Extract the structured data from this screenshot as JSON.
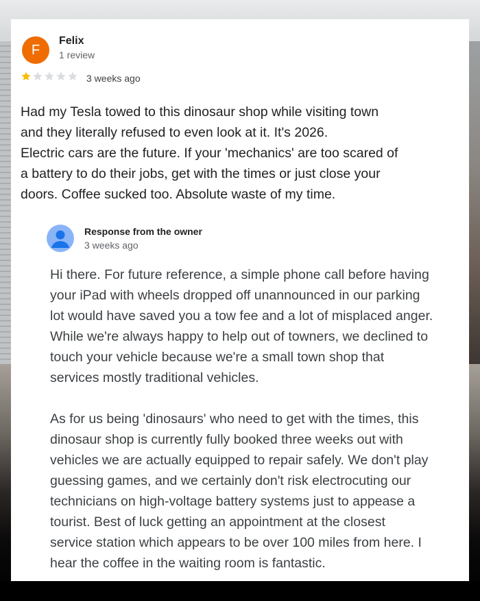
{
  "review": {
    "avatar_letter": "F",
    "avatar_color": "#ef6c00",
    "reviewer_name": "Felix",
    "review_count": "1 review",
    "rating": 1,
    "max_rating": 5,
    "star_filled_color": "#fbbc04",
    "star_empty_color": "#dadce0",
    "time_ago": "3 weeks ago",
    "text": "Had my Tesla towed to this dinosaur shop while visiting town\nand they literally refused to even look at it. It's 2026.\nElectric cars are the future. If your 'mechanics' are too scared of\na battery to do their jobs, get with the times or just close your\ndoors. Coffee sucked too. Absolute waste of my time."
  },
  "owner_response": {
    "avatar_icon": "person-icon",
    "label": "Response from the owner",
    "time_ago": "3 weeks ago",
    "text": "Hi there. For future reference, a simple phone call before having\nyour iPad with wheels dropped off unannounced in our parking\nlot would have saved you a tow fee and a lot of misplaced anger.\nWhile we're always happy to help out of towners, we declined to\ntouch your vehicle because we're a small town shop that\nservices mostly traditional vehicles.\n\nAs for us being 'dinosaurs' who need to get with the times, this\ndinosaur shop is currently fully booked three weeks out with\nvehicles we are actually equipped to repair safely. We don't play\nguessing games, and we certainly don't risk electrocuting our\ntechnicians on high-voltage battery systems just to appease a\ntourist. Best of luck getting an appointment at the closest\nservice station which appears to be over 100 miles from here. I\nhear the coffee in the waiting room is fantastic."
  }
}
